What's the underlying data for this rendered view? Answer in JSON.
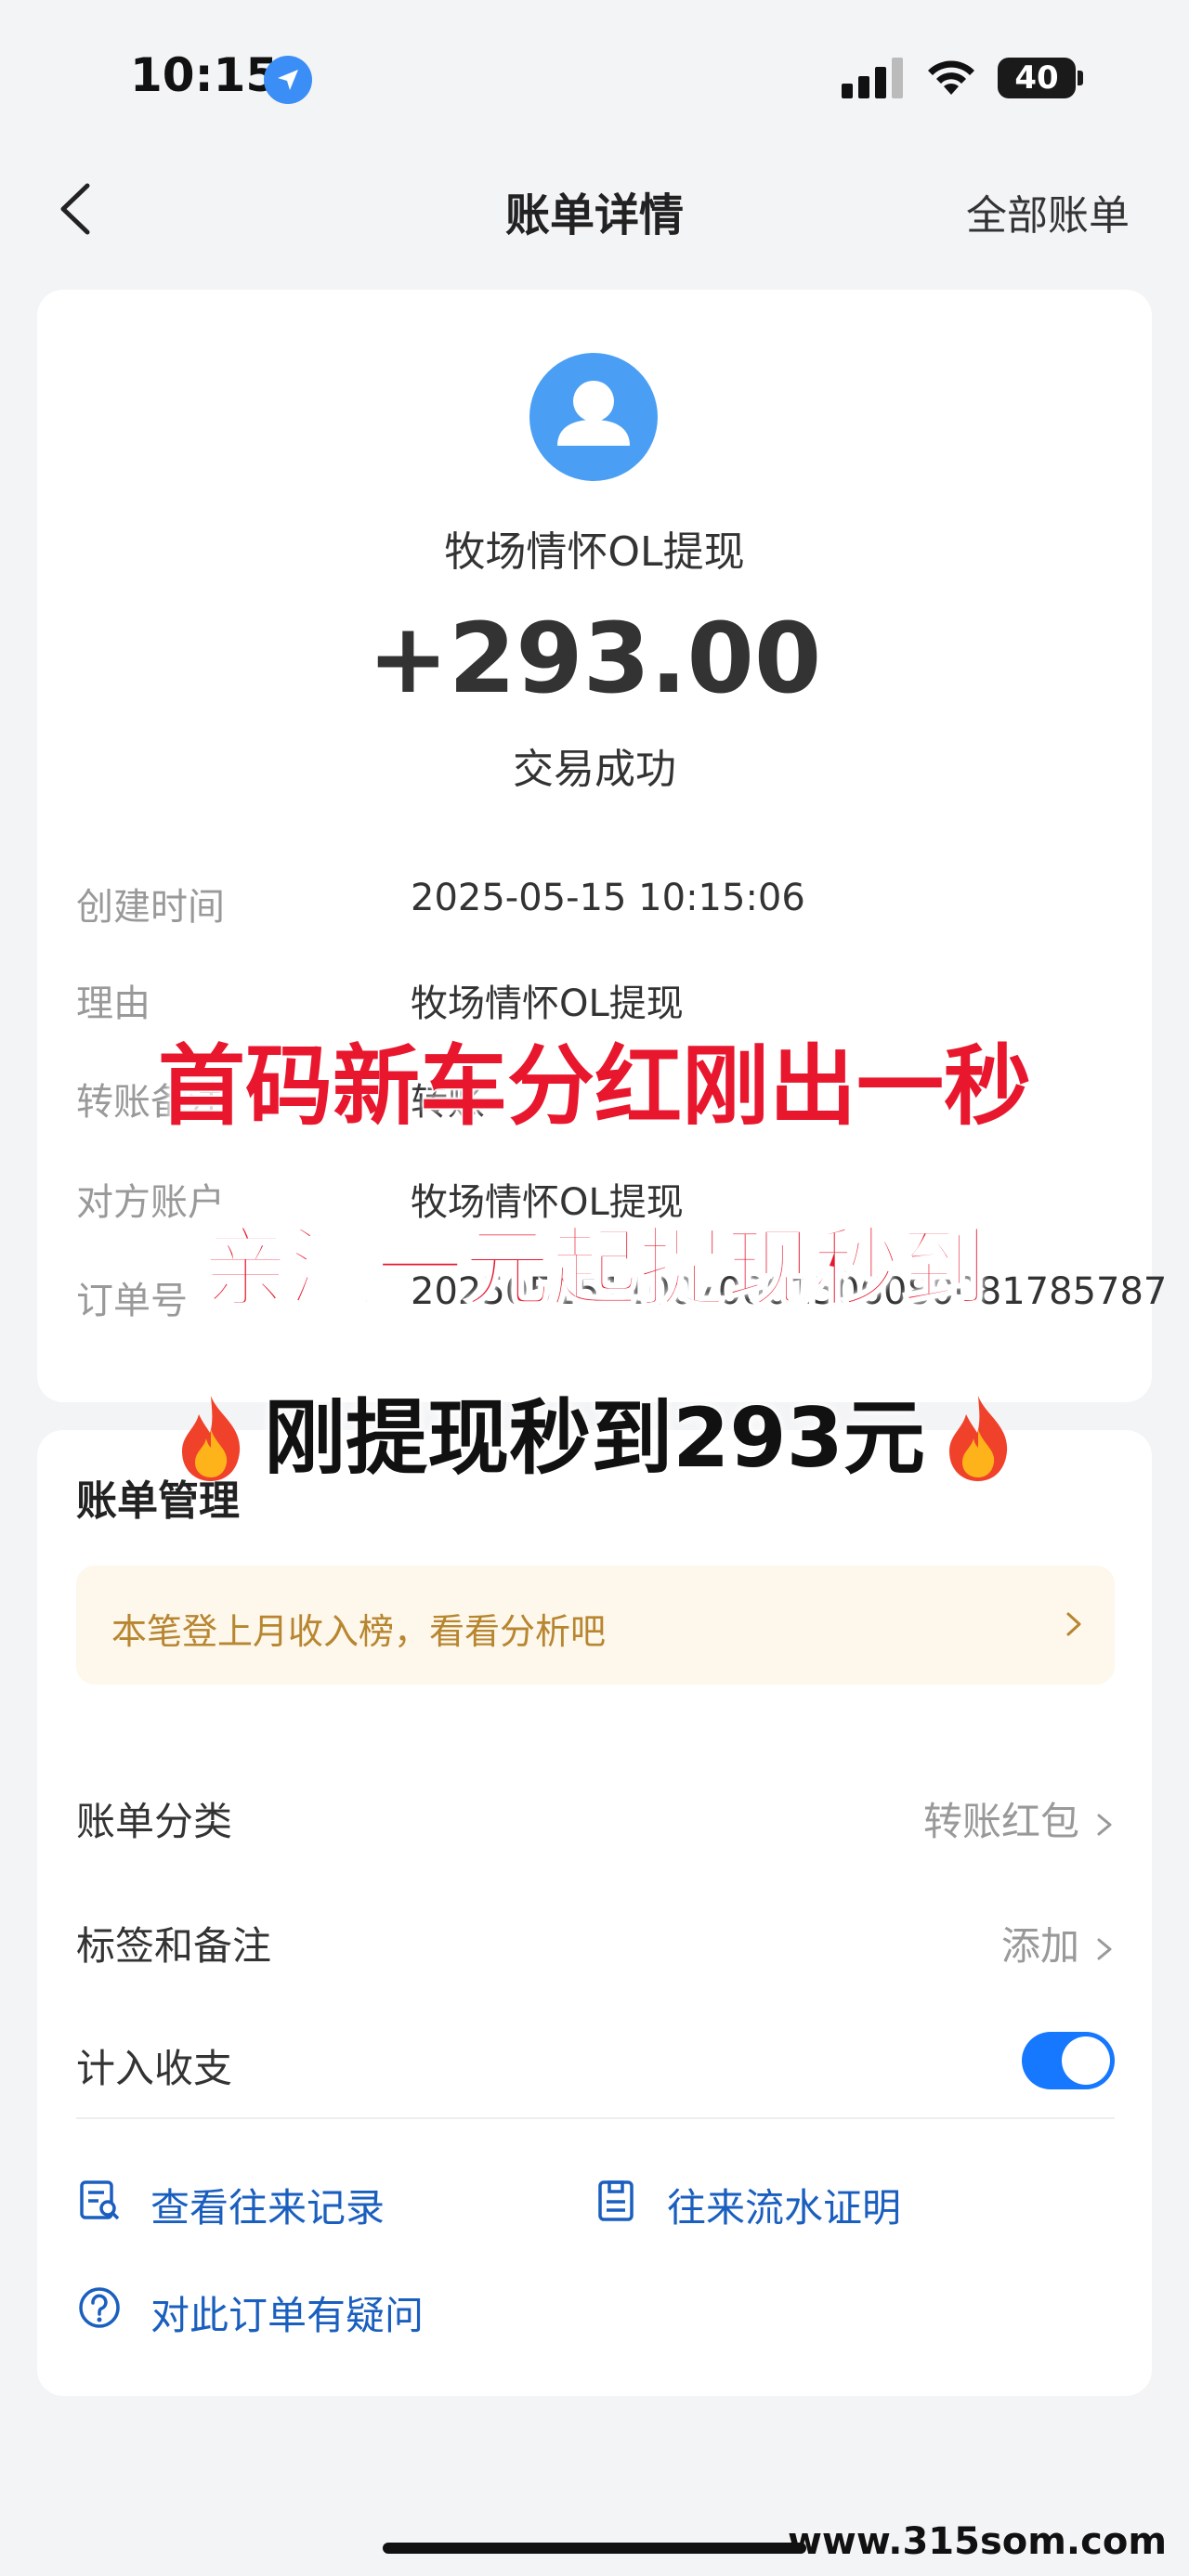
{
  "status_bar": {
    "time": "10:15",
    "battery": "40"
  },
  "nav": {
    "title": "账单详情",
    "right": "全部账单"
  },
  "bill": {
    "merchant": "牧场情怀OL提现",
    "amount": "+293.00",
    "status": "交易成功",
    "details": [
      {
        "label": "创建时间",
        "value": "2025-05-15 10:15:06"
      },
      {
        "label": "理由",
        "value": "牧场情怀OL提现"
      },
      {
        "label": "转账备注",
        "value": "转账"
      },
      {
        "label": "对方账户",
        "value": "牧场情怀OL提现"
      },
      {
        "label": "订单号",
        "value": "20250515110070001506080081785787"
      }
    ]
  },
  "promo": {
    "line1": "首码新车分红刚出一秒",
    "line2": "亲测一元起提现秒到",
    "line3": "刚提现秒到293元"
  },
  "management": {
    "title": "账单管理",
    "banner": "本笔登上月收入榜，看看分析吧",
    "category_label": "账单分类",
    "category_value": "转账红包",
    "tags_label": "标签和备注",
    "tags_value": "添加",
    "include_label": "计入收支",
    "include_on": true,
    "link_records": "查看往来记录",
    "link_proof": "往来流水证明",
    "link_question": "对此订单有疑问"
  },
  "watermark": "www.315som.com",
  "colors": {
    "accent": "#1677ff",
    "promo_red": "#e8172e",
    "banner_bg": "#fdf7ec",
    "banner_text": "#b7862f"
  }
}
